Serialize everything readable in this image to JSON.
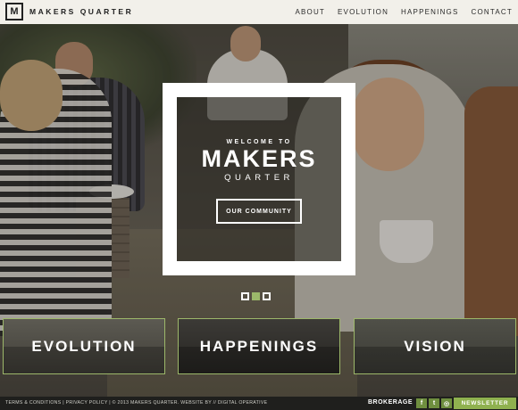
{
  "header": {
    "logo_mark": "M",
    "logo_text": "MAKERS QUARTER",
    "nav": [
      "ABOUT",
      "EVOLUTION",
      "HAPPENINGS",
      "CONTACT"
    ]
  },
  "hero": {
    "welcome_pre": "WELCOME TO",
    "welcome_title": "MAKERS",
    "welcome_sub": "QUARTER",
    "button_label": "OUR COMMUNITY",
    "slides": {
      "count": 3,
      "active_index": 1
    }
  },
  "tiles": [
    "EVOLUTION",
    "HAPPENINGS",
    "VISION"
  ],
  "footer": {
    "terms": "TERMS & CONDITIONS",
    "sep1": "|",
    "privacy": "PRIVACY POLICY",
    "sep2": "|",
    "copyright": "© 2013 MAKERS QUARTER. WEBSITE BY",
    "sep3": "//",
    "agency": "DIGITAL OPERATIVE",
    "brokerage": "BROKERAGE",
    "social": {
      "facebook": "f",
      "twitter": "t",
      "instagram": "◎"
    },
    "newsletter": "NEWSLETTER"
  },
  "colors": {
    "accent_green": "#8fb14f",
    "header_bg": "#f2f0ea",
    "footer_bg": "#1f1f1d"
  },
  "icons": [
    "logo-mark-icon",
    "facebook-icon",
    "twitter-icon",
    "instagram-icon"
  ]
}
